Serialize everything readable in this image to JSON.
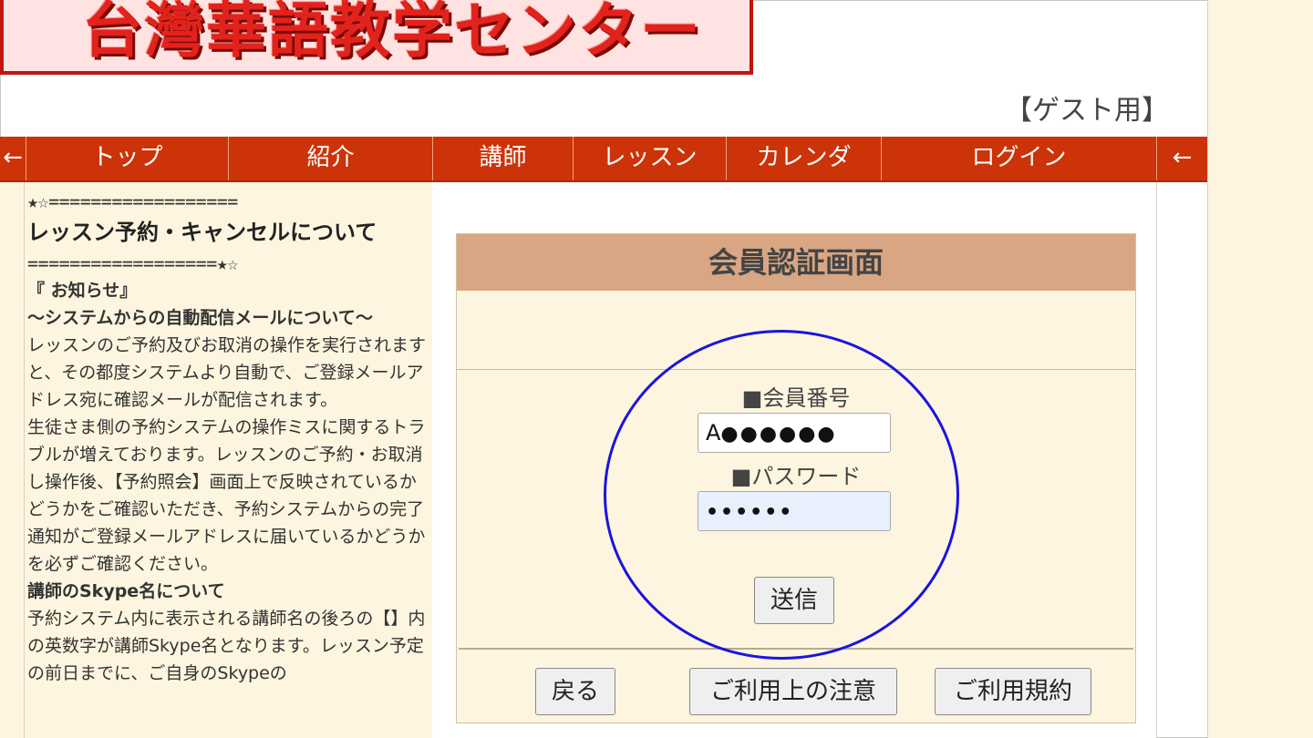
{
  "logo": {
    "title": "台灣華語教学センター"
  },
  "guest_label": "【ゲスト用】",
  "nav": {
    "prev_arrow": "←",
    "items": [
      "トップ",
      "紹介",
      "講師",
      "レッスン",
      "カレンダ",
      "ログイン"
    ],
    "next_arrow": "←"
  },
  "news": {
    "divider_top": "★☆==================",
    "headline": "レッスン予約・キャンセルについて",
    "divider_bottom": "==================★☆",
    "notice_heading": "『 お知らせ』",
    "mail_heading": "～システムからの自動配信メールについて～",
    "para1": "レッスンのご予約及びお取消の操作を実行されますと、その都度システムより自動で、ご登録メールアドレス宛に確認メールが配信されます。",
    "para2": "生徒さま側の予約システムの操作ミスに関するトラブルが増えております。レッスンのご予約・お取消し操作後、【予約照会】画面上で反映されているかどうかをご確認いただき、予約システムからの完了通知がご登録メールアドレスに届いているかどうかを必ずご確認ください。",
    "skype_heading": "講師のSkype名について",
    "para3": "予約システム内に表示される講師名の後ろの【】内の英数字が講師Skype名となります。レッスン予定の前日までに、ご自身のSkypeの"
  },
  "login": {
    "title": "会員認証画面",
    "member_label": "■会員番号",
    "member_value_prefix": "A",
    "member_mask": "●●●●●●",
    "password_label": "■パスワード",
    "password_mask": "••••••",
    "submit": "送信",
    "back": "戻る",
    "notes": "ご利用上の注意",
    "terms": "ご利用規約"
  },
  "colors": {
    "nav": "#cd3308",
    "login_header": "#d8a683",
    "panel_bg": "#fdf5df",
    "annotation_circle": "#1a14e0"
  }
}
